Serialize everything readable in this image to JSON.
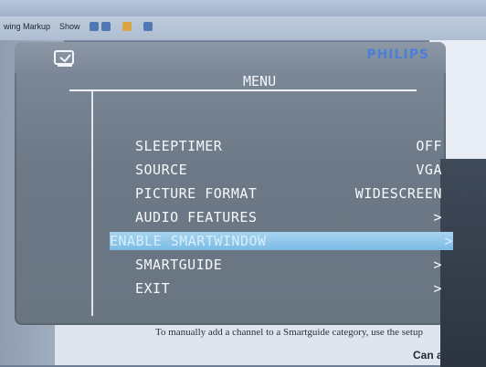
{
  "toolbar": {
    "items": [
      {
        "label": "wing Markup",
        "icon": "none"
      },
      {
        "label": "Show",
        "icon": "dropdown"
      },
      {
        "label": "",
        "icon": "review-icons"
      },
      {
        "label": "",
        "icon": "folder"
      },
      {
        "label": "",
        "icon": "track-changes"
      }
    ]
  },
  "brand": "PHILIPS",
  "menu": {
    "title": "MENU",
    "items": [
      {
        "label": "SLEEPTIMER",
        "value": "OFF",
        "selected": false
      },
      {
        "label": "SOURCE",
        "value": "VGA",
        "selected": false
      },
      {
        "label": "PICTURE FORMAT",
        "value": "WIDESCREEN",
        "selected": false
      },
      {
        "label": "AUDIO FEATURES",
        "value": ">",
        "selected": false
      },
      {
        "label": "ENABLE SMARTWINDOW",
        "value": ">",
        "selected": true
      },
      {
        "label": "SMARTGUIDE",
        "value": ">",
        "selected": false
      },
      {
        "label": "EXIT",
        "value": ">",
        "selected": false
      }
    ]
  },
  "background_text": {
    "caption": "To manually add a channel to a Smartguide category, use the setup",
    "right_heading": "Can a chan"
  },
  "colors": {
    "highlight": "#8ec9ee",
    "brand": "#4a7fd6",
    "osd_bg": "#7a8796"
  }
}
